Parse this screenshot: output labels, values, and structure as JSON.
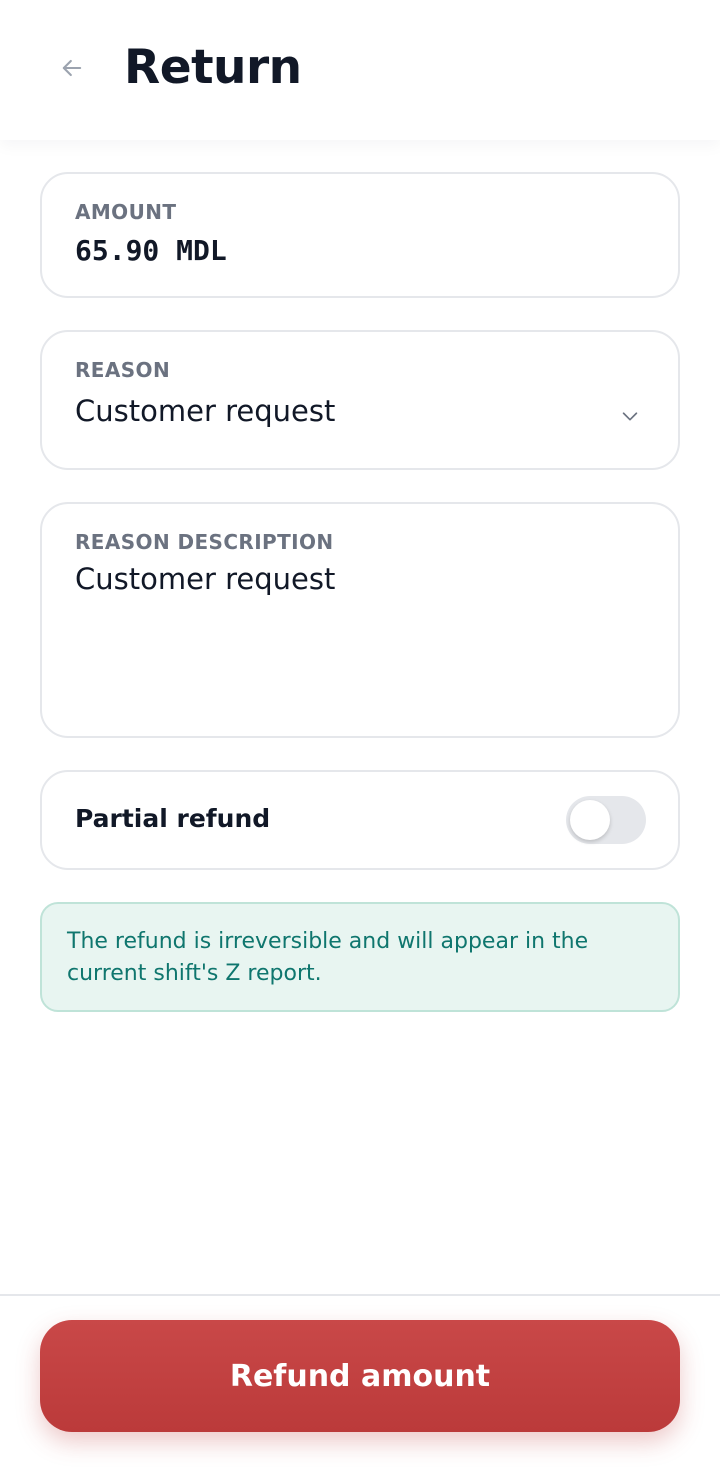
{
  "header": {
    "title": "Return",
    "back_icon": "arrow-left-icon"
  },
  "amount_field": {
    "label": "AMOUNT",
    "value": "65.90 MDL"
  },
  "reason_field": {
    "label": "REASON",
    "selected_value": "Customer request",
    "icon": "chevron-down-icon"
  },
  "reason_description_field": {
    "label": "REASON DESCRIPTION",
    "value": "Customer request"
  },
  "partial_refund": {
    "label": "Partial refund",
    "enabled": false
  },
  "notice": {
    "text": "The refund is irreversible and will appear in the current shift's Z report."
  },
  "footer": {
    "primary_button_label": "Refund amount"
  },
  "colors": {
    "primary": "#c0403f",
    "notice_background": "#e8f5f1",
    "notice_text": "#0f766e",
    "card_border": "#e5e7eb"
  }
}
